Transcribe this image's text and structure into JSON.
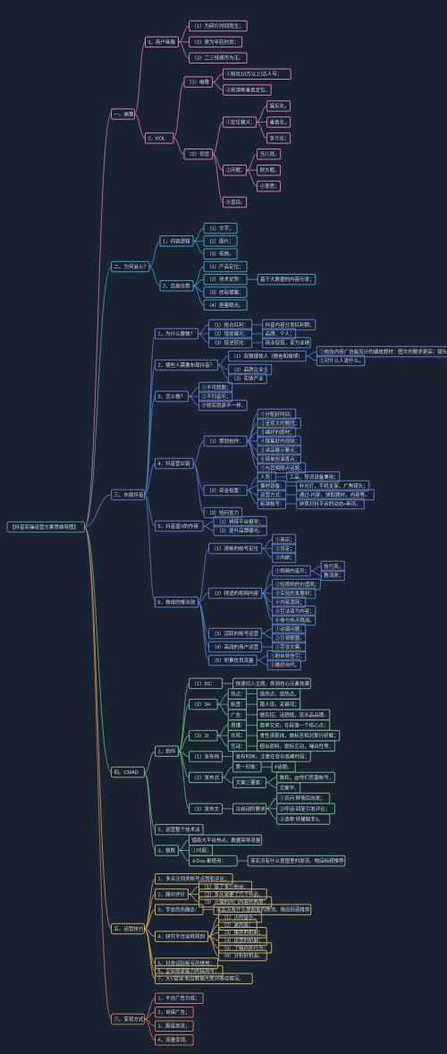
{
  "title": "【抖音实操运营方案思维导图】",
  "colors": {
    "root": "#4a9b7f",
    "c1": "#d47ba8",
    "c2": "#4a9bc4",
    "c3": "#5a7fc4",
    "c4": "#6bb58a",
    "c5": "#c8a858",
    "c6": "#c87858"
  },
  "tree": {
    "t": "【抖音实操运营方案思维导图】",
    "c": "root",
    "k": [
      {
        "t": "一。画像",
        "c": "c1",
        "k": [
          {
            "t": "1，用户画像",
            "k": [
              {
                "t": "（1）为碎片时间而生；"
              },
              {
                "t": "（2）更为年轻时尚；"
              },
              {
                "t": "（3）二三线城市为主。"
              }
            ]
          },
          {
            "t": "2，KOL",
            "k": [
              {
                "t": "（1）画像",
                "k": [
                  {
                    "t": "①粉丝10万以上/达人号；"
                  },
                  {
                    "t": "②有清晰垂直定位。"
                  }
                ]
              },
              {
                "t": "（2）切忌",
                "k": [
                  {
                    "t": "①定位模义：",
                    "k": [
                      {
                        "t": "娱乐化，"
                      },
                      {
                        "t": "垂直化，"
                      },
                      {
                        "t": "多元化；"
                      }
                    ]
                  },
                  {
                    "t": "②问题：",
                    "k": [
                      {
                        "t": "当儿戏，"
                      },
                      {
                        "t": "财大粗，"
                      },
                      {
                        "t": "小意思；"
                      }
                    ]
                  },
                  {
                    "t": "③盲目。"
                  }
                ]
              }
            ]
          }
        ]
      },
      {
        "t": "二。为何会火？",
        "c": "c2",
        "k": [
          {
            "t": "1，内容逻辑",
            "k": [
              {
                "t": "（1）文字；"
              },
              {
                "t": "（2）图片；"
              },
              {
                "t": "（3）视频。"
              }
            ]
          },
          {
            "t": "2，自身优势",
            "k": [
              {
                "t": "（1）产品定位；"
              },
              {
                "t": "（2）技术优势：",
                "k": [
                  {
                    "t": "基于大数据的内容分发；"
                  }
                ]
              },
              {
                "t": "（3）经验借鉴；"
              },
              {
                "t": "（4）胆量眼光。"
              }
            ]
          }
        ]
      },
      {
        "t": "三。布局抖音",
        "c": "c3",
        "k": [
          {
            "t": "1，为什么要做？",
            "k": [
              {
                "t": "（1）抢占红利：",
                "k": [
                  {
                    "t": "抖音内容分发红利期；"
                  }
                ]
              },
              {
                "t": "（2）增加曝光：",
                "k": [
                  {
                    "t": "品牌，个人；"
                  }
                ]
              },
              {
                "t": "（3）促进转化：",
                "k": [
                  {
                    "t": "商业促现，变为业绩"
                  }
                ]
              }
            ]
          },
          {
            "t": "2，哪些人需要布局抖音？",
            "k": [
              {
                "t": "（1）双微媒体人（微信和微博）",
                "k": [
                  {
                    "t": "①校验内容广告能没计的编故题材：图文的要求更高：镜头语言不足。"
                  },
                  {
                    "t": "②对什么人说什么。"
                  }
                ]
              },
              {
                "t": "（2）品牌企业主"
              },
              {
                "t": "（3）实体产业"
              }
            ]
          },
          {
            "t": "3，怎么做？",
            "k": [
              {
                "t": "①不可脱脱；"
              },
              {
                "t": "②不归音乐；"
              },
              {
                "t": "③修实就原不一样。"
              }
            ]
          },
          {
            "t": "4，抖音营业链",
            "k": [
              {
                "t": "（1）策划创作：",
                "k": [
                  {
                    "t": "①分配好时间；"
                  },
                  {
                    "t": "②呈现文的题团；"
                  },
                  {
                    "t": "③编好的题材；"
                  },
                  {
                    "t": "④撰集好的视频；"
                  },
                  {
                    "t": "⑤读品展示要点；"
                  },
                  {
                    "t": "⑥简单扮演喜点；"
                  },
                  {
                    "t": "⑦与其相随点话题。"
                  }
                ]
              },
              {
                "t": "（2）资金投置：",
                "k": [
                  {
                    "t": "人员：",
                    "k": [
                      {
                        "t": "工品，导流设备兼用；"
                      }
                    ]
                  },
                  {
                    "t": "摄材设备：",
                    "k": [
                      {
                        "t": "补光灯，手机支架，广角镜头；"
                      }
                    ]
                  },
                  {
                    "t": "运营方式：",
                    "k": [
                      {
                        "t": "通过-内部，馈取题材，内容等。"
                      }
                    ]
                  },
                  {
                    "t": "标准帐号：",
                    "k": [
                      {
                        "t": "钟表对抖平台的动态+新风。"
                      }
                    ]
                  }
                ]
              },
              {
                "t": "（3）知何发力"
              }
            ]
          },
          {
            "t": "5，抖音蓝V的作用",
            "k": [
              {
                "t": "（1）候保平台报导；"
              },
              {
                "t": "（2）提升品牌曝光。"
              }
            ]
          },
          {
            "t": "6，做成的推法则",
            "k": [
              {
                "t": "（1）清晰的帐号定位",
                "k": [
                  {
                    "t": "①商店；"
                  },
                  {
                    "t": "②设定；"
                  },
                  {
                    "t": "③内统；"
                  }
                ]
              },
              {
                "t": "（2）得适的视网内容",
                "k": [
                  {
                    "t": "①视频内音乐；",
                    "k": [
                      {
                        "t": "技巧风，"
                      },
                      {
                        "t": "教流类；"
                      }
                    ]
                  },
                  {
                    "t": "②短视频的价值观；"
                  },
                  {
                    "t": "③实验的发展材；"
                  },
                  {
                    "t": "④内容源简；"
                  },
                  {
                    "t": "⑤巨法读为内容；"
                  },
                  {
                    "t": "⑥参与热点挑战。"
                  }
                ]
              },
              {
                "t": "（3）活跃的帐号运营",
                "k": [
                  {
                    "t": "①动调问题；"
                  },
                  {
                    "t": "②引领联盟。"
                  }
                ]
              },
              {
                "t": "（4）高阔的用户运营",
                "k": [
                  {
                    "t": "①劳设文案。"
                  }
                ]
              },
              {
                "t": "（5）积累优良流量",
                "k": [
                  {
                    "t": "①粉丝效信引；"
                  },
                  {
                    "t": "②做好自代。"
                  }
                ]
              }
            ]
          }
        ]
      },
      {
        "t": "四。CMAD",
        "c": "c4",
        "k": [
          {
            "t": "1，创作",
            "k": [
              {
                "t": "（1）5S：",
                "k": [
                  {
                    "t": "快速切入主题，抓到核心元素效果"
                  }
                ]
              },
              {
                "t": "（2）3H",
                "k": [
                  {
                    "t": "热点：",
                    "k": [
                      {
                        "t": "造热点，追热点。"
                      }
                    ]
                  },
                  {
                    "t": "标签：",
                    "k": [
                      {
                        "t": "蹭人设，关键词；"
                      }
                    ]
                  },
                  {
                    "t": "广告：",
                    "k": [
                      {
                        "t": "做实招，话题植，流水品品牌。"
                      }
                    ]
                  }
                ]
              },
              {
                "t": "（3）3I",
                "k": [
                  {
                    "t": "易懂：",
                    "k": [
                      {
                        "t": "简单又买，在段落一个核心点；"
                      }
                    ]
                  },
                  {
                    "t": "共鸣：",
                    "k": [
                      {
                        "t": "食性该蓟线，做标答相对那行好解；"
                      }
                    ]
                  },
                  {
                    "t": "互动：",
                    "k": [
                      {
                        "t": "植似原料，提标互动，哺合性等；"
                      }
                    ]
                  }
                ]
              },
              {
                "t": "（1）发布间",
                "k": [
                  {
                    "t": "发布时间，注意在受众高峰时段；"
                  }
                ]
              },
              {
                "t": "（2）发布式",
                "k": [
                  {
                    "t": "第一印象：",
                    "k": [
                      {
                        "t": "#话题。"
                      }
                    ]
                  },
                  {
                    "t": "文案三要素：",
                    "k": [
                      {
                        "t": "做和，@他们官塞帐号，"
                      },
                      {
                        "t": "文案字。"
                      }
                    ]
                  }
                ]
              },
              {
                "t": "（3）发布文",
                "k": [
                  {
                    "t": "冷启动阶要求",
                    "k": [
                      {
                        "t": "①讯问:群情后向发；"
                      },
                      {
                        "t": "②呼话:回复引发评论；"
                      },
                      {
                        "t": "③选参:转播稿非3。"
                      }
                    ]
                  }
                ]
              }
            ]
          },
          {
            "t": "2，运营整个技术派"
          },
          {
            "t": "3，做数",
            "k": [
              {
                "t": "借助大平台热点。数据架导流量"
              },
              {
                "t": "①问题；"
              },
              {
                "t": "②Dou.都使用：",
                "k": [
                  {
                    "t": "某实况有什么意图里的原流。物品标题推荐"
                  }
                ]
              }
            ]
          }
        ]
      },
      {
        "t": "五。运营技巧",
        "c": "c5",
        "k": [
          {
            "t": "1，多关注同类帐号点赞和评论；"
          },
          {
            "t": "2，蹭问评价",
            "k": [
              {
                "t": "（1）留了多少粉丝；"
              },
              {
                "t": "（2）多从里要了几个作品；"
              },
              {
                "t": "（3）火爆的内门内容的热度；"
              }
            ]
          },
          {
            "t": "3，学会热热蹭态：",
            "k": [
              {
                "t": "某实况有什么意图里的原流。物品标题推荐"
              }
            ]
          },
          {
            "t": "4，研究平台运转规则",
            "k": [
              {
                "t": "（1）火的音乐；"
              },
              {
                "t": "（2）家的是；"
              },
              {
                "t": "（3）推荐的机制；"
              },
              {
                "t": "（4）运营的机制；"
              },
              {
                "t": "（5）了解内外行为；"
              },
              {
                "t": "（6）分析好机会。"
              }
            ]
          },
          {
            "t": "5，抖音试标帐号的使用；"
          },
          {
            "t": "6，企业账家能力的搞到号；"
          },
          {
            "t": "7，大V益读:和且数据大致对等成情况。"
          }
        ]
      },
      {
        "t": "六。变现方式",
        "c": "c6",
        "k": [
          {
            "t": "1，平台广告分成；"
          },
          {
            "t": "2，自接广告；"
          },
          {
            "t": "3，跟梁卖货；"
          },
          {
            "t": "4，流量变现。"
          }
        ]
      }
    ]
  }
}
